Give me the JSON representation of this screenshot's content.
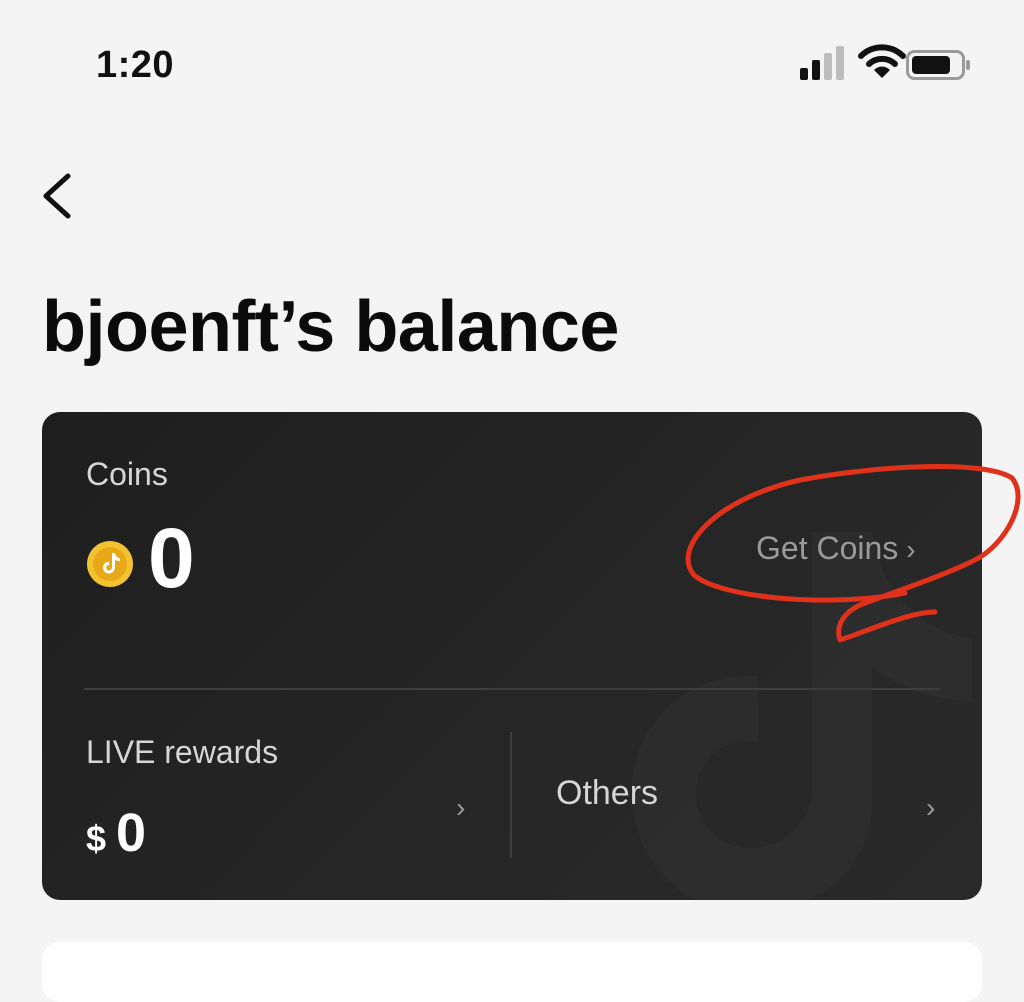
{
  "status_bar": {
    "time": "1:20",
    "icons": [
      "signal-icon",
      "wifi-icon",
      "battery-icon"
    ]
  },
  "header": {
    "back_icon": "chevron-left-icon",
    "title": "bjoenft’s balance"
  },
  "balance_card": {
    "coins_label": "Coins",
    "coin_icon": "tiktok-coin-icon",
    "coins_value": "0",
    "get_coins_label": "Get Coins",
    "get_coins_chevron": "›",
    "live_rewards_label": "LIVE rewards",
    "live_currency": "$",
    "live_value": "0",
    "live_chevron": "›",
    "others_label": "Others",
    "others_chevron": "›"
  },
  "colors": {
    "page_bg": "#f4f4f4",
    "card_bg": "#232323",
    "coin_gold": "#f2c230",
    "annotation_red": "#e0311b"
  }
}
